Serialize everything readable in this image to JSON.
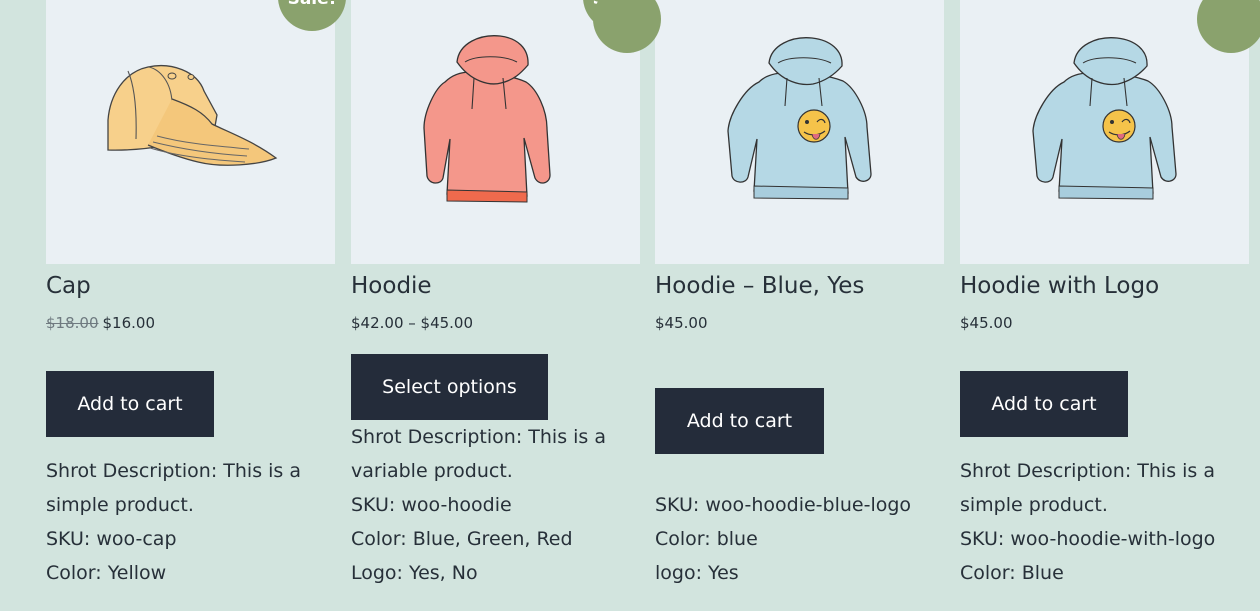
{
  "products": [
    {
      "title": "Cap",
      "sale_badge": "Sale!",
      "regular_price": "$18.00",
      "sale_price": "$16.00",
      "button_label": "Add to cart",
      "description": "Shrot Description: This is a",
      "description2": "simple product.",
      "sku": "SKU: woo-cap",
      "attr": "Color: Yellow"
    },
    {
      "title": "Hoodie",
      "sale_badge": "Sale!",
      "price_range": "$42.00 – $45.00",
      "button_label": "Select options",
      "description": "Shrot Description: This is a",
      "description2": "variable product.",
      "sku": "SKU: woo-hoodie",
      "attr": "Color: Blue, Green, Red",
      "attr2": "Logo: Yes, No"
    },
    {
      "title": "Hoodie – Blue, Yes",
      "price": "$45.00",
      "button_label": "Add to cart",
      "sku": "SKU: woo-hoodie-blue-logo",
      "attr": "Color: blue",
      "attr2": "logo: Yes"
    },
    {
      "title": "Hoodie with Logo",
      "price": "$45.00",
      "button_label": "Add to cart",
      "description": "Shrot Description: This is a",
      "description2": "simple product.",
      "sku": "SKU: woo-hoodie-with-logo",
      "attr": "Color: Blue"
    }
  ],
  "colors": {
    "page_background": "#d2e4de",
    "image_background": "#eaf0f4",
    "button_background": "#242c3a",
    "sale_badge": "#8aa26d",
    "text": "#273039"
  },
  "icons": [
    "cap-image",
    "hoodie-image",
    "blue-hoodie-logo-image",
    "blue-hoodie-logo-image"
  ]
}
